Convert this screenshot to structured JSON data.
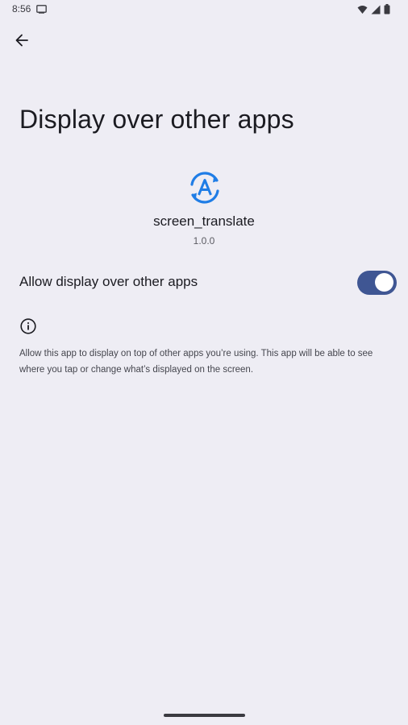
{
  "status_bar": {
    "time": "8:56",
    "icons": [
      "screen-cast-icon",
      "wifi-icon",
      "signal-icon",
      "battery-icon"
    ]
  },
  "toolbar": {
    "back_icon": "back-arrow-icon"
  },
  "page": {
    "title": "Display over other apps"
  },
  "app": {
    "icon": "translate-app-icon",
    "name": "screen_translate",
    "version": "1.0.0"
  },
  "permission": {
    "label": "Allow display over other apps",
    "enabled": true
  },
  "info": {
    "icon": "info-icon",
    "text": "Allow this app to display on top of other apps you’re using. This app will be able to see where you tap or change what’s displayed on the screen."
  },
  "colors": {
    "background": "#eeedf4",
    "switch_track": "#3f5693",
    "app_icon_blue": "#1f7de6"
  }
}
